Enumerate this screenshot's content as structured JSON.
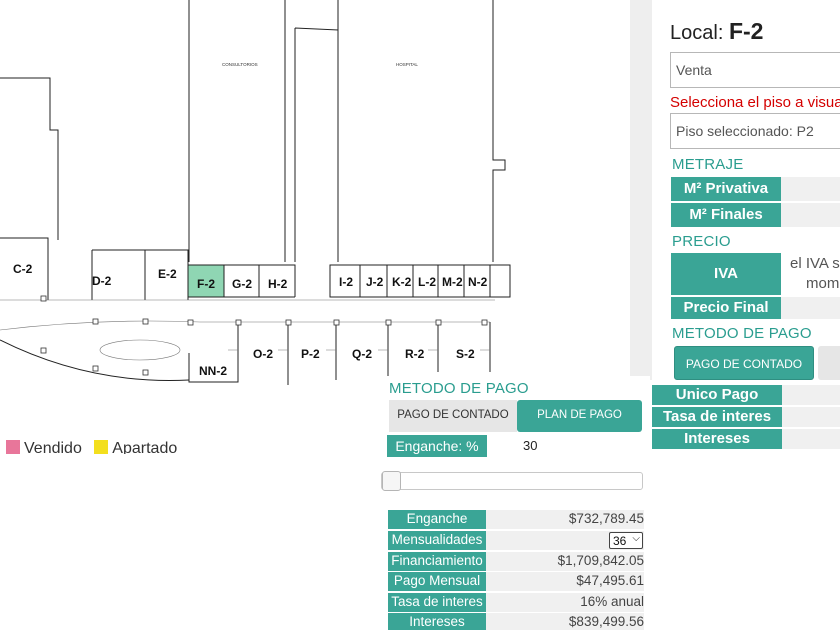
{
  "plan": {
    "building_labels": [
      "CONSULTORIOS",
      "HOSPITAL"
    ],
    "selected_local": "F-2",
    "selected_color": "#8fd6b3",
    "units": [
      "C-2",
      "D-2",
      "E-2",
      "F-2",
      "G-2",
      "H-2",
      "I-2",
      "J-2",
      "K-2",
      "L-2",
      "M-2",
      "N-2",
      "NN-2",
      "O-2",
      "P-2",
      "Q-2",
      "R-2",
      "S-2"
    ]
  },
  "legend": {
    "items": [
      {
        "label": "Vendido",
        "color": "#e8769a"
      },
      {
        "label": "Apartado",
        "color": "#f3df1e"
      }
    ]
  },
  "info": {
    "local_prefix": "Local:",
    "local_id": "F-2",
    "status_field": "Venta",
    "floor_prompt": "Selecciona el piso a visual",
    "floor_selected": "Piso seleccionado: P2",
    "metraje_title": "METRAJE",
    "m2_privativa_label": "M² Privativa",
    "m2_finales_label": "M² Finales",
    "precio_title": "PRECIO",
    "iva_label": "IVA",
    "iva_note_1": "el IVA s",
    "iva_note_2": "mom",
    "precio_final_label": "Precio Final",
    "metodo_title": "METODO DE PAGO",
    "pago_contado_button": "PAGO DE CONTADO",
    "unico_pago_label": "Unico Pago",
    "tasa_label": "Tasa de interes",
    "intereses_label": "Intereses"
  },
  "payment": {
    "title": "METODO DE PAGO",
    "tab_contado": "PAGO DE CONTADO",
    "tab_plan": "PLAN DE PAGO",
    "enganche_pct_label": "Enganche: %",
    "enganche_pct_value": "30",
    "slider_percent": 0,
    "rows": [
      {
        "label": "Enganche",
        "value": "$732,789.45"
      },
      {
        "label": "Mensualidades",
        "value": "36",
        "is_select": true
      },
      {
        "label": "Financiamiento",
        "value": "$1,709,842.05"
      },
      {
        "label": "Pago Mensual",
        "value": "$47,495.61"
      },
      {
        "label": "Tasa de interes",
        "value": "16% anual"
      },
      {
        "label": "Intereses",
        "value": "$839,499.56"
      }
    ]
  },
  "colors": {
    "accent": "#3aa596",
    "warning": "#d40000"
  }
}
